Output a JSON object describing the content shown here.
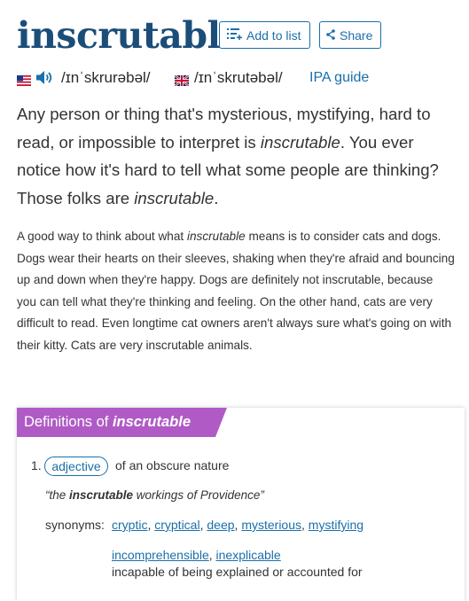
{
  "entry": {
    "word": "inscrutable",
    "add_to_list": "Add to list",
    "share": "Share"
  },
  "pronunciation": {
    "us_ipa": "/ɪnˈskrurəbəl/",
    "uk_ipa": "/ɪnˈskrutəbəl/",
    "ipa_guide": "IPA guide"
  },
  "short_def": {
    "p1": "Any person or thing that's mysterious, mystifying, hard to read, or impossible to interpret is ",
    "em1": "inscrutable",
    "p2": ". You ever notice how it's hard to tell what some people are thinking? Those folks are ",
    "em2": "inscrutable",
    "p3": "."
  },
  "long_def": {
    "p1": "A good way to think about what ",
    "em1": "inscrutable",
    "p2": " means is to consider cats and dogs. Dogs wear their hearts on their sleeves, shaking when they're afraid and bouncing up and down when they're happy. Dogs are definitely not inscrutable, because you can tell what they're thinking and feeling. On the other hand, cats are very difficult to read. Even longtime cat owners aren't always sure what's going on with their kitty. Cats are very inscrutable animals."
  },
  "definitions": {
    "heading_prefix": "Definitions of ",
    "heading_word": "inscrutable",
    "banner_color": "#b05bc5",
    "senses": [
      {
        "number": "1.",
        "pos": "adjective",
        "gloss": "of an obscure nature",
        "example_open": "“the ",
        "example_word": "inscrutable",
        "example_rest": " workings of Providence”",
        "synonyms_label": "synonyms:",
        "synonyms_row1": [
          "cryptic",
          "cryptical",
          "deep",
          "mysterious",
          "mystifying"
        ],
        "synonyms_row2": [
          "incomprehensible",
          "inexplicable"
        ],
        "synonyms_row2_gloss": "incapable of being explained or accounted for"
      }
    ]
  },
  "colors": {
    "word": "#1b4d79",
    "link": "#1a6faa",
    "banner": "#b05bc5"
  }
}
